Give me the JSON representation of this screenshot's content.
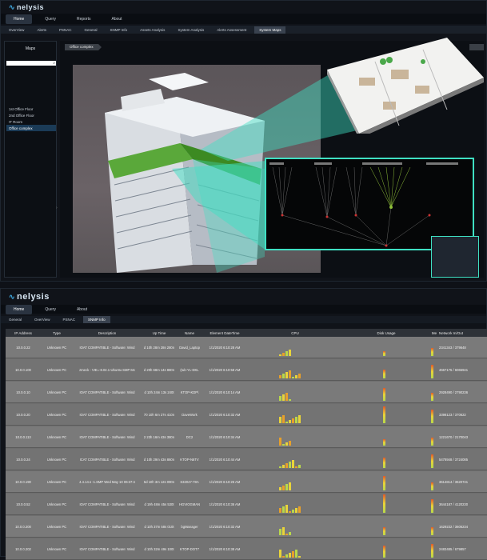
{
  "window1": {
    "app_name": "nelysis",
    "menu": [
      "Home",
      "Query",
      "Reports",
      "About"
    ],
    "active_menu": "Home",
    "tabs": [
      "OverView",
      "Alerts",
      "PSNAC",
      "General",
      "SNMP Info",
      "Assets Analysis",
      "System Analysis",
      "Alerts Assessment",
      "System Maps"
    ],
    "active_tab": "System Maps",
    "sidebar": {
      "title": "Maps",
      "items": [
        "1st Office Floor",
        "2nd Office Floor",
        "IT Room",
        "Office complex"
      ],
      "active_item": "Office complex"
    },
    "breadcrumb": "Office complex",
    "accent_color": "#3fe0c3"
  },
  "window2": {
    "app_name": "nelysis",
    "menu": [
      "Home",
      "Query",
      "About"
    ],
    "active_menu": "Home",
    "tabs": [
      "General",
      "OverView",
      "PSNAC",
      "SNMP Info"
    ],
    "active_tab": "SNMP Info",
    "table": {
      "columns": [
        "IP Address",
        "Type",
        "Description",
        "Up Time",
        "Name",
        "Element DateTime",
        "CPU",
        "Disk Usage",
        "Me",
        "Network In/Out"
      ],
      "rows": [
        {
          "ip": "10.0.0.22",
          "type": "Unknown PC",
          "desc": "IOAT COMPATIBLE - Software: Wind",
          "up": "d 10h 28m 28s 280n",
          "name": "David_Laptop",
          "date": "1/1/2020 6:10:28 AM",
          "net": "2341343 / 379648"
        },
        {
          "ip": "10.0.0.100",
          "type": "Unknown PC",
          "desc": "zmeck - VIE=-8.04.1-Ubuntu SMP Mc",
          "up": "d 20h 68m 14s 880n",
          "name": "(tub-YL-DKL",
          "date": "1/1/2020 6:10:58 AM",
          "net": "4667175 / 6065941"
        },
        {
          "ip": "10.0.0.10",
          "type": "Unknown PC",
          "desc": "IOAT COMPATIBLE - Software: Wind",
          "up": "d 10h 24m 13s 240t",
          "name": "KTOP-KDP\\",
          "date": "1/1/2020 6:10:14 AM",
          "net": "2928490 / 2790236"
        },
        {
          "ip": "10.0.0.20",
          "type": "Unknown PC",
          "desc": "IOAT COMPATIBLE - Software: Wind",
          "up": "70 10h 6m 27s 410n",
          "name": "DaveWork",
          "date": "1/1/2020 6:10:32 AM",
          "net": "3398123 / 370622"
        },
        {
          "ip": "10.0.0.113",
          "type": "Unknown PC",
          "desc": "IOAT COMPATIBLE - Software: Wind",
          "up": "2 23h 16m 43s 380n",
          "name": "DC2",
          "date": "1/1/2020 6:10:34 AM",
          "net": "1221670 / 2170043"
        },
        {
          "ip": "10.0.0.24",
          "type": "Unknown PC",
          "desc": "ICAT COMPATIBLE - Software: Wind",
          "up": "d 10h 29m 43s 860n",
          "name": "KTOP-N6TV",
          "date": "1/1/2020 6:10:44 AM",
          "net": "5478948 / 3724085"
        },
        {
          "ip": "10.0.0.190",
          "type": "Unknown PC",
          "desc": "4.4.14.s -1.SMP Wed May 10 06:37:4",
          "up": "5d 10h 3m 12s 090n",
          "name": "S32047-78A",
          "date": "1/1/2020 6:10:26 AM",
          "net": "3614814 / 3620741"
        },
        {
          "ip": "10.0.0.52",
          "type": "Unknown PC",
          "desc": "IOAT COMPATIBLE - Software: Wind",
          "up": "d 19h 48m 45s 530t",
          "name": "HGVIOGMAN",
          "date": "1/1/2020 6:10:36 AM",
          "net": "3644187 / 4120230"
        },
        {
          "ip": "10.0.0.200",
          "type": "Unknown PC",
          "desc": "IOAT COMPATIBLE - Software: Wind",
          "up": "d 10h 37m 58s 010t",
          "name": "bgManager",
          "date": "1/1/2020 6:10:32 AM",
          "net": "1629232 / 3606234"
        },
        {
          "ip": "10.0.0.202",
          "type": "Unknown PC",
          "desc": "IOAT COMPATIBLE - Software: Wind",
          "up": "d 10h 32m 49s 100t",
          "name": "KTOP-DOT7",
          "date": "1/1/2020 6:10:38 AM",
          "net": "2483485 / 679857"
        }
      ]
    }
  }
}
